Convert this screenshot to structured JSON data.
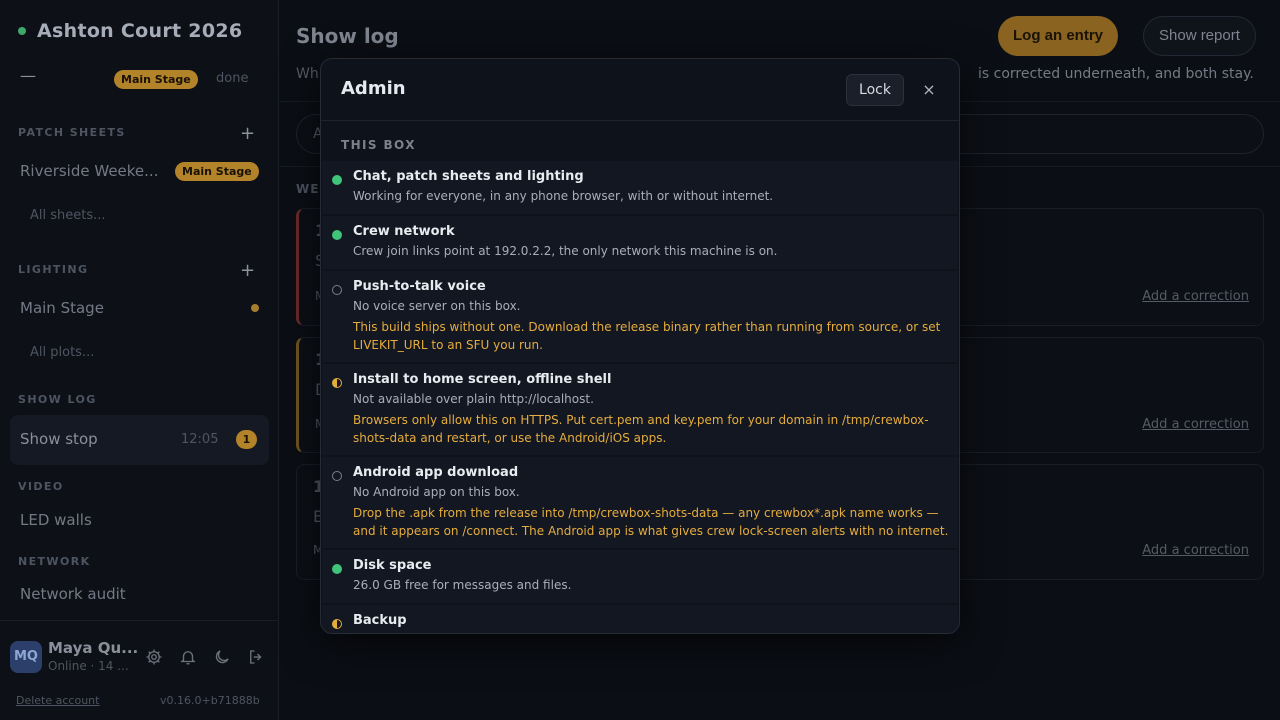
{
  "sidebar": {
    "project_title": "Ashton Court 2026",
    "dash": "—",
    "stage_pill": "Main Stage",
    "done_label": "done",
    "patch_sheets": {
      "heading": "PATCH SHEETS",
      "add": "+",
      "item": "Riverside Weeke...",
      "item_pill": "Main Stage",
      "all": "All sheets..."
    },
    "lighting": {
      "heading": "LIGHTING",
      "add": "+",
      "item": "Main Stage",
      "all": "All plots..."
    },
    "show_log": {
      "heading": "SHOW LOG",
      "item": "Show stop",
      "time": "12:05",
      "badge": "1"
    },
    "video": {
      "heading": "VIDEO",
      "item": "LED walls"
    },
    "network": {
      "heading": "NETWORK",
      "item": "Network audit"
    },
    "user": {
      "initials": "MQ",
      "name": "Maya Qu...",
      "status": "Online · 14 ..."
    },
    "delete_account": "Delete account",
    "version": "v0.16.0+b71888b"
  },
  "main": {
    "title": "Show log",
    "log_button": "Log an entry",
    "report_button": "Show report",
    "intro_left": "Wh",
    "intro_right": "is corrected underneath, and both stay.",
    "search_text": "A",
    "week_label": "WE",
    "cards": [
      {
        "num": "1",
        "letter": "S",
        "meta": "M",
        "correction": "Add a correction"
      },
      {
        "num": "1",
        "letter": "D",
        "meta": "M",
        "correction": "Add a correction"
      },
      {
        "num": "1",
        "letter": "E",
        "meta": "M",
        "correction": "Add a correction"
      }
    ]
  },
  "modal": {
    "title": "Admin",
    "lock_button": "Lock",
    "close": "×",
    "section": "THIS BOX",
    "rows": [
      {
        "status": "ok",
        "title": "Chat, patch sheets and lighting",
        "desc": "Working for everyone, in any phone browser, with or without internet.",
        "warning": ""
      },
      {
        "status": "ok",
        "title": "Crew network",
        "desc": "Crew join links point at 192.0.2.2, the only network this machine is on.",
        "warning": ""
      },
      {
        "status": "off",
        "title": "Push-to-talk voice",
        "desc": "No voice server on this box.",
        "warning": "This build ships without one. Download the release binary rather than running from source, or set LIVEKIT_URL to an SFU you run."
      },
      {
        "status": "half",
        "title": "Install to home screen, offline shell",
        "desc": "Not available over plain http://localhost.",
        "warning": "Browsers only allow this on HTTPS. Put cert.pem and key.pem for your domain in /tmp/crewbox-shots-data and restart, or use the Android/iOS apps."
      },
      {
        "status": "off",
        "title": "Android app download",
        "desc": "No Android app on this box.",
        "warning": "Drop the .apk from the release into /tmp/crewbox-shots-data — any crewbox*.apk name works — and it appears on /connect. The Android app is what gives crew lock-screen alerts with no internet."
      },
      {
        "status": "ok",
        "title": "Disk space",
        "desc": "26.0 GB free for messages and files.",
        "warning": ""
      },
      {
        "status": "half",
        "title": "Backup",
        "desc": "",
        "warning": ""
      }
    ]
  },
  "colors": {
    "accent": "#b3832a",
    "ok": "#3fc47a",
    "warning": "#e5ac3e"
  }
}
